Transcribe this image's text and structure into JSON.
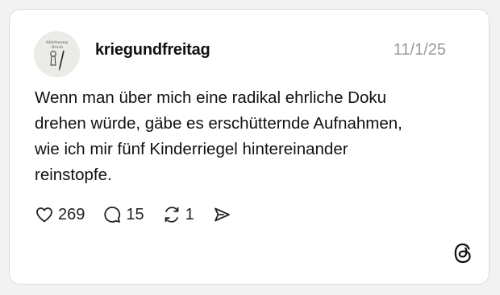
{
  "post": {
    "username": "kriegundfreitag",
    "date": "11/1/25",
    "avatar_text": [
      "Ablehnung",
      "Bruch"
    ],
    "text_lines": [
      "Wenn man über mich eine radikal ehrliche Doku",
      "drehen würde, gäbe es erschütternde Aufnahmen,",
      "wie ich mir fünf Kinderriegel hintereinander",
      "reinstopfe."
    ],
    "likes": "269",
    "replies": "15",
    "reposts": "1"
  },
  "icons": {
    "like": "heart-icon",
    "reply": "speech-bubble-icon",
    "repost": "repost-icon",
    "share": "send-icon",
    "brand": "threads-logo-icon"
  },
  "colors": {
    "text": "#111111",
    "date": "#9a9a9a",
    "card_border": "#dcdcdc",
    "background": "#f2f2f2"
  }
}
